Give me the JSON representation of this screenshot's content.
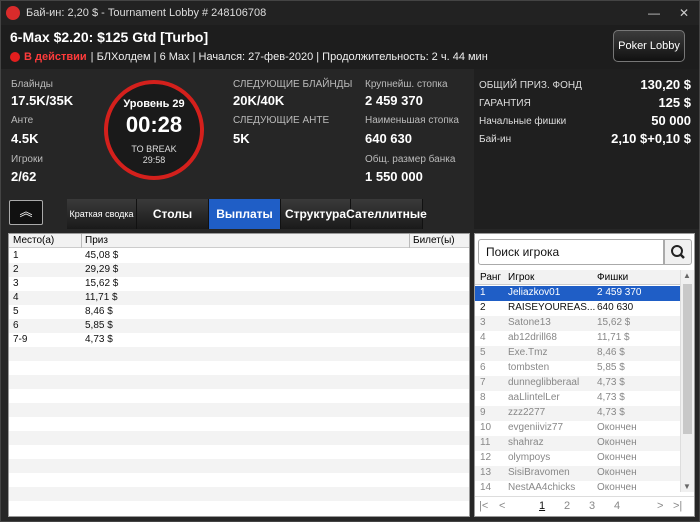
{
  "window": {
    "title": "Бай-ин: 2,20 $ - Tournament Lobby # 248106708",
    "minimize": "—",
    "close": "✕"
  },
  "header": {
    "title": "6-Max $2.20: $125 Gtd [Turbo]",
    "status": "В действии",
    "details": "| БЛХолдем | 6 Max | Начался: 27-фев-2020 | Продолжительность: 2 ч. 44 мин",
    "lobby_button": "Poker Lobby"
  },
  "info": {
    "blinds_label": "Блайнды",
    "blinds": "17.5K/35K",
    "ante_label": "Анте",
    "ante": "4.5K",
    "players_label": "Игроки",
    "players": "2/62",
    "level": "Уровень 29",
    "clock": "00:28",
    "to_break_label": "TO BREAK",
    "to_break": "29:58",
    "next_blinds_label": "СЛЕДУЮЩИЕ БЛАЙНДЫ",
    "next_blinds": "20K/40K",
    "next_ante_label": "СЛЕДУЮЩИЕ АНТЕ",
    "next_ante": "5K",
    "largest_stack_label": "Крупнейш. стопка",
    "largest_stack": "2 459 370",
    "smallest_stack_label": "Наименьшая стопка",
    "smallest_stack": "640 630",
    "total_bank_label": "Общ. размер банка",
    "total_bank": "1 550 000"
  },
  "prize": [
    {
      "label": "ОБЩИЙ ПРИЗ. ФОНД",
      "value": "130,20 $"
    },
    {
      "label": "ГАРАНТИЯ",
      "value": "125 $"
    },
    {
      "label": "Начальные фишки",
      "value": "50 000"
    },
    {
      "label": "Бай-ин",
      "value": "2,10 $+0,10 $"
    }
  ],
  "collapse_glyph": "︽",
  "tabs": [
    "Краткая сводка",
    "Столы",
    "Выплаты",
    "Структура",
    "Сателлитные"
  ],
  "payouts": {
    "headers": [
      "Место(а)",
      "Приз",
      "Билет(ы)"
    ],
    "rows": [
      {
        "place": "1",
        "prize": "45,08 $"
      },
      {
        "place": "2",
        "prize": "29,29 $"
      },
      {
        "place": "3",
        "prize": "15,62 $"
      },
      {
        "place": "4",
        "prize": "11,71 $"
      },
      {
        "place": "5",
        "prize": "8,46 $"
      },
      {
        "place": "6",
        "prize": "5,85 $"
      },
      {
        "place": "7-9",
        "prize": "4,73 $"
      }
    ]
  },
  "players": {
    "search_placeholder": "Поиск игрока",
    "headers": [
      "Ранг",
      "Игрок",
      "Фишки"
    ],
    "rows": [
      {
        "rank": "1",
        "name": "Jeliazkov01",
        "chips": "2 459 370"
      },
      {
        "rank": "2",
        "name": "RAISEYOUREAS...",
        "chips": "640 630"
      },
      {
        "rank": "3",
        "name": "Satone13",
        "chips": "15,62 $"
      },
      {
        "rank": "4",
        "name": "ab12drill68",
        "chips": "11,71 $"
      },
      {
        "rank": "5",
        "name": "Exe.Tmz",
        "chips": "8,46 $"
      },
      {
        "rank": "6",
        "name": "tombsten",
        "chips": "5,85 $"
      },
      {
        "rank": "7",
        "name": "dunneglibberaal",
        "chips": "4,73 $"
      },
      {
        "rank": "8",
        "name": "aaLlintelLer",
        "chips": "4,73 $"
      },
      {
        "rank": "9",
        "name": "zzz2277",
        "chips": "4,73 $"
      },
      {
        "rank": "10",
        "name": "evgeniiviz77",
        "chips": "Окончен"
      },
      {
        "rank": "11",
        "name": "shahraz",
        "chips": "Окончен"
      },
      {
        "rank": "12",
        "name": "olympoys",
        "chips": "Окончен"
      },
      {
        "rank": "13",
        "name": "SisiBravomen",
        "chips": "Окончен"
      },
      {
        "rank": "14",
        "name": "NestAA4chicks",
        "chips": "Окончен"
      }
    ],
    "pager": {
      "first": "|<",
      "prev": "<",
      "pages": [
        "1",
        "2",
        "3",
        "4"
      ],
      "next": ">",
      "last": ">|"
    }
  }
}
